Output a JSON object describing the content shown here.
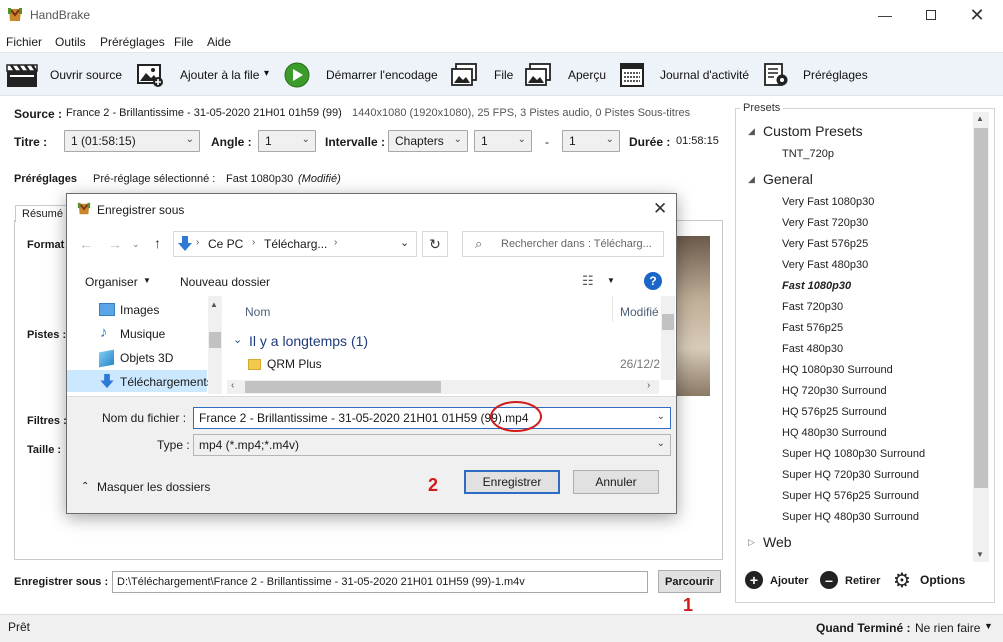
{
  "window": {
    "title": "HandBrake"
  },
  "menu": [
    "Fichier",
    "Outils",
    "Préréglages",
    "File",
    "Aide"
  ],
  "toolbar": {
    "open_source": "Ouvrir source",
    "add_queue": "Ajouter à la file",
    "add_queue_arrow": "▾",
    "start_encode": "Démarrer l'encodage",
    "queue": "File",
    "preview": "Aperçu",
    "activity_log": "Journal d'activité",
    "presets": "Préréglages"
  },
  "source": {
    "label": "Source :",
    "value": "France 2 - Brillantissime - 31-05-2020 21H01 01h59 (99)",
    "info": "1440x1080 (1920x1080), 25 FPS, 3 Pistes audio, 0 Pistes Sous-titres"
  },
  "title_row": {
    "title_label": "Titre :",
    "title_value": "1 (01:58:15)",
    "angle_label": "Angle :",
    "angle_value": "1",
    "interval_label": "Intervalle :",
    "interval_value": "Chapters",
    "from_value": "1",
    "dash": "-",
    "to_value": "1",
    "duration_label": "Durée :",
    "duration_value": "01:58:15"
  },
  "preset_row": {
    "label": "Préréglages",
    "selected_label": "Pré-réglage sélectionné :",
    "selected_value": "Fast 1080p30",
    "modified": "(Modifié)"
  },
  "tabs": {
    "summary": "Résumé"
  },
  "left_labels": {
    "format": "Format",
    "tracks": "Pistes :",
    "filters": "Filtres :",
    "size": "Taille :"
  },
  "presets_panel": {
    "title": "Presets",
    "custom": "Custom Presets",
    "custom_items": [
      "TNT_720p"
    ],
    "general": "General",
    "general_items": [
      "Very Fast 1080p30",
      "Very Fast 720p30",
      "Very Fast 576p25",
      "Very Fast 480p30",
      "Fast 1080p30",
      "Fast 720p30",
      "Fast 576p25",
      "Fast 480p30",
      "HQ 1080p30 Surround",
      "HQ 720p30 Surround",
      "HQ 576p25 Surround",
      "HQ 480p30 Surround",
      "Super HQ 1080p30 Surround",
      "Super HQ 720p30 Surround",
      "Super HQ 576p25 Surround",
      "Super HQ 480p30 Surround"
    ],
    "web": "Web",
    "add": "Ajouter",
    "remove": "Retirer",
    "options": "Options"
  },
  "save": {
    "label": "Enregistrer sous :",
    "path": "D:\\Téléchargement\\France 2 - Brillantissime - 31-05-2020 21H01 01H59 (99)-1.m4v",
    "browse": "Parcourir"
  },
  "status": {
    "ready": "Prêt",
    "when_done_label": "Quand Terminé :",
    "when_done_value": "Ne rien faire"
  },
  "annotations": {
    "one": "1",
    "two": "2"
  },
  "dialog": {
    "title": "Enregistrer sous",
    "breadcrumb": [
      "Ce PC",
      "Télécharg..."
    ],
    "search_placeholder": "Rechercher dans : Télécharg...",
    "organize": "Organiser",
    "new_folder": "Nouveau dossier",
    "nav_items": [
      "Images",
      "Musique",
      "Objets 3D",
      "Téléchargements"
    ],
    "col_name": "Nom",
    "col_modified": "Modifié",
    "group": "Il y a longtemps (1)",
    "file_name": "QRM Plus",
    "file_date": "26/12/2",
    "filename_label": "Nom du fichier :",
    "filename_value": "France 2 - Brillantissime - 31-05-2020 21H01 01H59 (99)",
    "filename_ext": ".mp4",
    "type_label": "Type :",
    "type_value": "mp4 (*.mp4;*.m4v)",
    "hide_folders": "Masquer les dossiers",
    "save_btn": "Enregistrer",
    "cancel_btn": "Annuler"
  },
  "colors": {
    "accent_red": "#d11a1a",
    "toolbar_bg": "#eef3f9",
    "selection": "#cce8ff"
  }
}
